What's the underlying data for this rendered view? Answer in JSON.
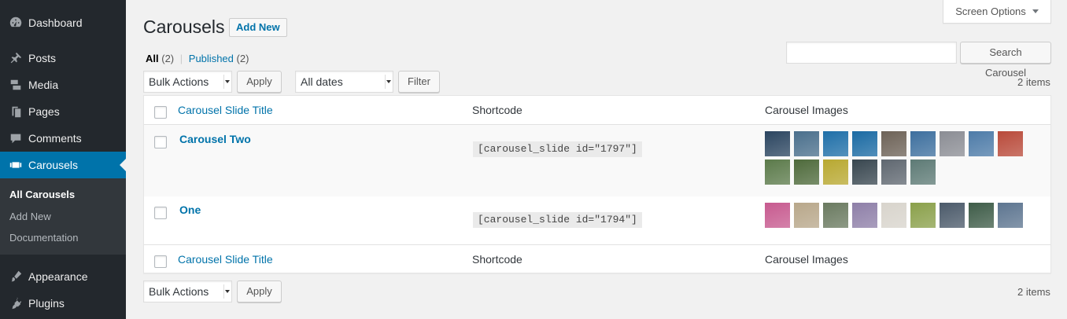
{
  "sidebar": {
    "items": [
      {
        "label": "Dashboard",
        "icon": "dashboard-icon"
      },
      {
        "label": "Posts",
        "icon": "pin-icon"
      },
      {
        "label": "Media",
        "icon": "media-icon"
      },
      {
        "label": "Pages",
        "icon": "pages-icon"
      },
      {
        "label": "Comments",
        "icon": "comment-icon"
      },
      {
        "label": "Carousels",
        "icon": "carousel-icon"
      }
    ],
    "submenu": [
      "All Carousels",
      "Add New",
      "Documentation"
    ],
    "items_after": [
      {
        "label": "Appearance",
        "icon": "brush-icon"
      },
      {
        "label": "Plugins",
        "icon": "plugin-icon"
      }
    ],
    "active_color": "#0073aa"
  },
  "screen_options": "Screen Options",
  "page": {
    "title": "Carousels",
    "add_new": "Add New"
  },
  "filters": {
    "all_label": "All",
    "all_count": "(2)",
    "separator": "|",
    "published_label": "Published",
    "published_count": "(2)"
  },
  "search": {
    "button": "Search Carousel",
    "value": ""
  },
  "bulk": {
    "top": {
      "select": "Bulk Actions",
      "apply": "Apply",
      "dates": "All dates",
      "filter": "Filter",
      "count": "2 items"
    },
    "bottom": {
      "select": "Bulk Actions",
      "apply": "Apply",
      "count": "2 items"
    }
  },
  "table": {
    "columns": [
      "Carousel Slide Title",
      "Shortcode",
      "Carousel Images"
    ],
    "rows": [
      {
        "title": "Carousel Two",
        "shortcode": "[carousel_slide id=\"1797\"]",
        "images": [
          "#2b4560",
          "#4a6f8c",
          "#1f6fa8",
          "#1a6aa3",
          "#6d6257",
          "#3d6f9e",
          "#8b8d94",
          "#4d7ba8",
          "#b94a3a",
          "#5b7a4a",
          "#4e6a3b",
          "#b8a830",
          "#38464f",
          "#5f6770",
          "#5d7a75"
        ]
      },
      {
        "title": "One",
        "shortcode": "[carousel_slide id=\"1794\"]",
        "images": [
          "#c75a8f",
          "#b8a78a",
          "#6a7a60",
          "#8e7fa8",
          "#d8d4cc",
          "#8aa04a",
          "#4b5a6a",
          "#3e5c48",
          "#5d7590"
        ]
      }
    ]
  }
}
